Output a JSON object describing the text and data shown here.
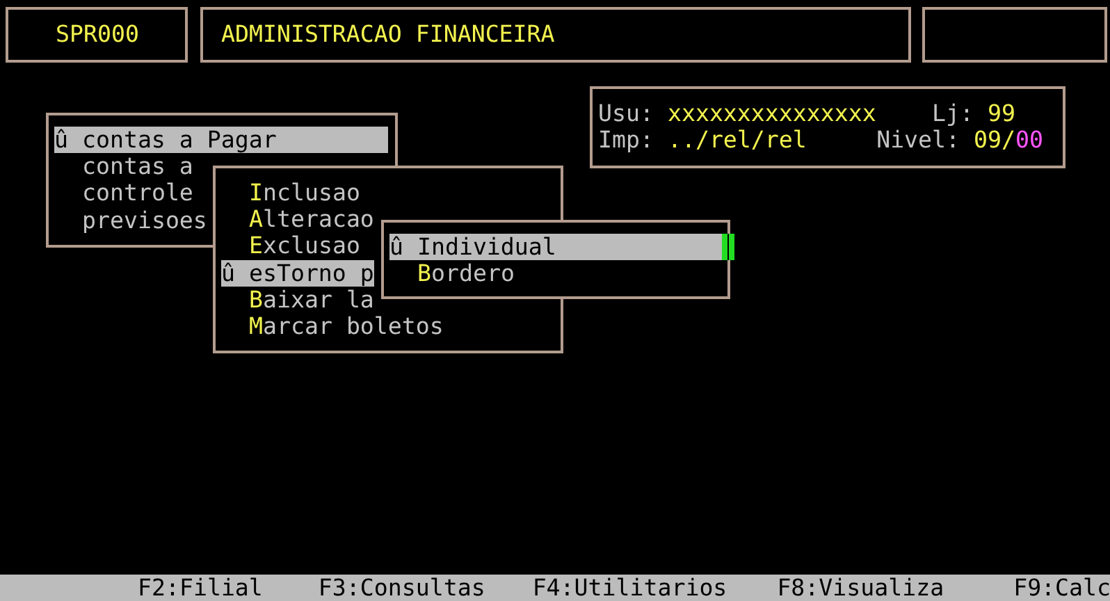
{
  "header": {
    "program_code": "SPR000",
    "title": "ADMINISTRACAO FINANCEIRA"
  },
  "info": {
    "user_label": "Usu:",
    "user": "xxxxxxxxxxxxxxx",
    "store_label": "Lj:",
    "store": "99",
    "printer_label": "Imp:",
    "printer": "../rel/rel",
    "level_label": "Nivel:",
    "level_major": "09/",
    "level_minor": "00"
  },
  "main_menu": [
    {
      "label": "û contas a Pagar",
      "selected": true
    },
    {
      "label": "contas a",
      "selected": false
    },
    {
      "label": "controle",
      "selected": false
    },
    {
      "label": "previsoes",
      "selected": false
    }
  ],
  "submenu": [
    {
      "label": "Inclusao",
      "selected": false
    },
    {
      "label": "Alteracao",
      "selected": false
    },
    {
      "label": "Exclusao",
      "selected": false
    },
    {
      "label": "û esTorno p",
      "selected": true
    },
    {
      "label": "Baixar la",
      "selected": false
    },
    {
      "label": "Marcar boletos",
      "selected": false
    }
  ],
  "sub_submenu": [
    {
      "label": "û Individual",
      "selected": true
    },
    {
      "label": "Bordero",
      "selected": false
    }
  ],
  "function_keys": [
    "F2:Filial",
    "F3:Consultas",
    "F4:Utilitarios",
    "F8:Visualiza",
    "F9:Calc"
  ]
}
